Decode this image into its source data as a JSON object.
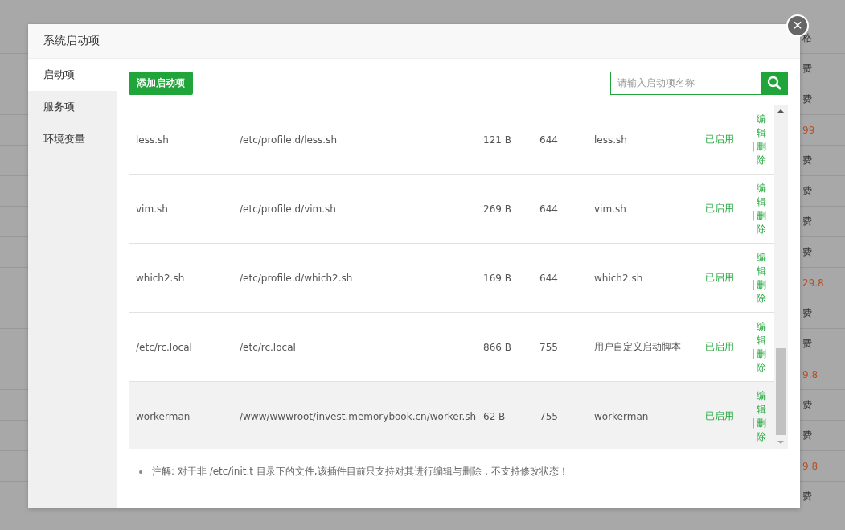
{
  "background": {
    "prices": [
      {
        "text": "格",
        "paid": false
      },
      {
        "text": "费",
        "paid": false
      },
      {
        "text": "费",
        "paid": false
      },
      {
        "text": "99",
        "paid": true
      },
      {
        "text": "费",
        "paid": false
      },
      {
        "text": "费",
        "paid": false
      },
      {
        "text": "费",
        "paid": false
      },
      {
        "text": "费",
        "paid": false
      },
      {
        "text": "29.8",
        "paid": true
      },
      {
        "text": "费",
        "paid": false
      },
      {
        "text": "费",
        "paid": false
      },
      {
        "text": "9.8",
        "paid": true
      },
      {
        "text": "费",
        "paid": false
      },
      {
        "text": "费",
        "paid": false
      },
      {
        "text": "9.8",
        "paid": true
      },
      {
        "text": "费",
        "paid": false
      }
    ]
  },
  "dialog": {
    "title": "系统启动项",
    "close": "×",
    "sidebar": {
      "items": [
        {
          "label": "启动项",
          "selected": true
        },
        {
          "label": "服务项",
          "selected": false
        },
        {
          "label": "环境变量",
          "selected": false
        }
      ]
    },
    "add_button": "添加启动项",
    "search": {
      "placeholder": "请输入启动项名称"
    },
    "table": {
      "rows": [
        {
          "name": "less.sh",
          "path": "/etc/profile.d/less.sh",
          "size": "121 B",
          "mode": "644",
          "description": "less.sh",
          "status": "已启用",
          "actions": [
            "编辑",
            "删除"
          ],
          "separator": "|",
          "hovered": false
        },
        {
          "name": "vim.sh",
          "path": "/etc/profile.d/vim.sh",
          "size": "269 B",
          "mode": "644",
          "description": "vim.sh",
          "status": "已启用",
          "actions": [
            "编辑",
            "删除"
          ],
          "separator": "|",
          "hovered": false
        },
        {
          "name": "which2.sh",
          "path": "/etc/profile.d/which2.sh",
          "size": "169 B",
          "mode": "644",
          "description": "which2.sh",
          "status": "已启用",
          "actions": [
            "编辑",
            "删除"
          ],
          "separator": "|",
          "hovered": false
        },
        {
          "name": "/etc/rc.local",
          "path": "/etc/rc.local",
          "size": "866 B",
          "mode": "755",
          "description": "用户自定义启动脚本",
          "status": "已启用",
          "actions": [
            "编辑",
            "删除"
          ],
          "separator": "|",
          "hovered": false
        },
        {
          "name": "workerman",
          "path": "/www/wwwroot/invest.memorybook.cn/worker.sh",
          "size": "62 B",
          "mode": "755",
          "description": "workerman",
          "status": "已启用",
          "actions": [
            "编辑",
            "删除"
          ],
          "separator": "|",
          "hovered": true
        }
      ]
    },
    "note": "注解: 对于非 /etc/init.t 目录下的文件,该插件目前只支持对其进行编辑与删除，不支持修改状态！"
  }
}
